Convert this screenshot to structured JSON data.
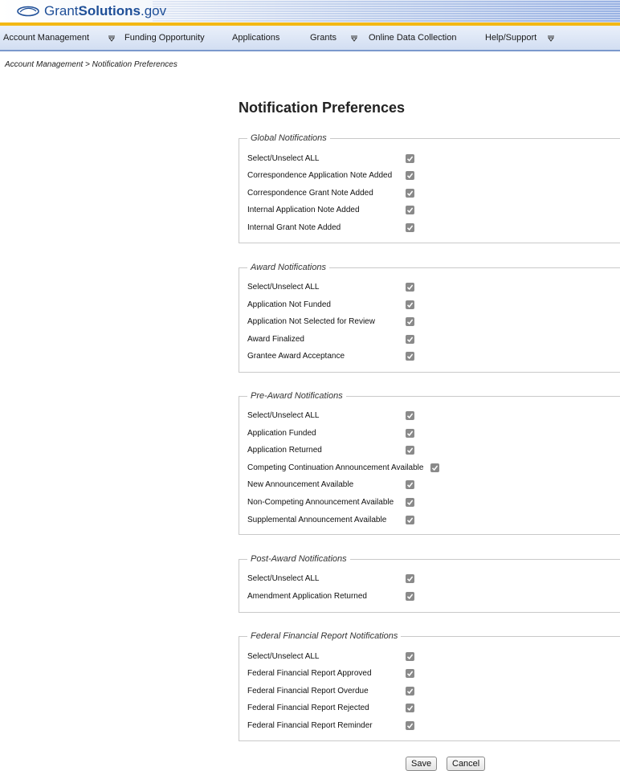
{
  "brand": {
    "name_regular": "Grant",
    "name_bold": "Solutions",
    "name_suffix": ".gov"
  },
  "nav": {
    "items": [
      {
        "label": "Account Management",
        "has_menu": true
      },
      {
        "label": "Funding Opportunity",
        "has_menu": false
      },
      {
        "label": "Applications",
        "has_menu": false
      },
      {
        "label": "Grants",
        "has_menu": true
      },
      {
        "label": "Online Data Collection",
        "has_menu": false
      },
      {
        "label": "Help/Support",
        "has_menu": true
      }
    ]
  },
  "breadcrumb": "Account Management > Notification Preferences",
  "page_title": "Notification Preferences",
  "sections": [
    {
      "legend": "Global Notifications",
      "items": [
        {
          "label": "Select/Unselect ALL",
          "checked": true
        },
        {
          "label": "Correspondence Application Note Added",
          "checked": true
        },
        {
          "label": "Correspondence Grant Note Added",
          "checked": true
        },
        {
          "label": "Internal Application Note Added",
          "checked": true
        },
        {
          "label": "Internal Grant Note Added",
          "checked": true
        }
      ]
    },
    {
      "legend": "Award Notifications",
      "items": [
        {
          "label": "Select/Unselect ALL",
          "checked": true
        },
        {
          "label": "Application Not Funded",
          "checked": true
        },
        {
          "label": "Application Not Selected for Review",
          "checked": true
        },
        {
          "label": "Award Finalized",
          "checked": true
        },
        {
          "label": "Grantee Award Acceptance",
          "checked": true
        }
      ]
    },
    {
      "legend": "Pre-Award Notifications",
      "items": [
        {
          "label": "Select/Unselect ALL",
          "checked": true
        },
        {
          "label": "Application Funded",
          "checked": true
        },
        {
          "label": "Application Returned",
          "checked": true
        },
        {
          "label": "Competing Continuation Announcement Available",
          "checked": true
        },
        {
          "label": "New Announcement Available",
          "checked": true
        },
        {
          "label": "Non-Competing Announcement Available",
          "checked": true
        },
        {
          "label": "Supplemental Announcement Available",
          "checked": true
        }
      ]
    },
    {
      "legend": "Post-Award Notifications",
      "items": [
        {
          "label": "Select/Unselect ALL",
          "checked": true
        },
        {
          "label": "Amendment Application Returned",
          "checked": true
        }
      ]
    },
    {
      "legend": "Federal Financial Report Notifications",
      "items": [
        {
          "label": "Select/Unselect ALL",
          "checked": true
        },
        {
          "label": "Federal Financial Report Approved",
          "checked": true
        },
        {
          "label": "Federal Financial Report Overdue",
          "checked": true
        },
        {
          "label": "Federal Financial Report Rejected",
          "checked": true
        },
        {
          "label": "Federal Financial Report Reminder",
          "checked": true
        }
      ]
    }
  ],
  "buttons": {
    "save": "Save",
    "cancel": "Cancel"
  },
  "colors": {
    "brand_blue": "#1f4f98",
    "accent_gold": "#f3b814",
    "checkbox_checked": "#8a8a8a"
  }
}
